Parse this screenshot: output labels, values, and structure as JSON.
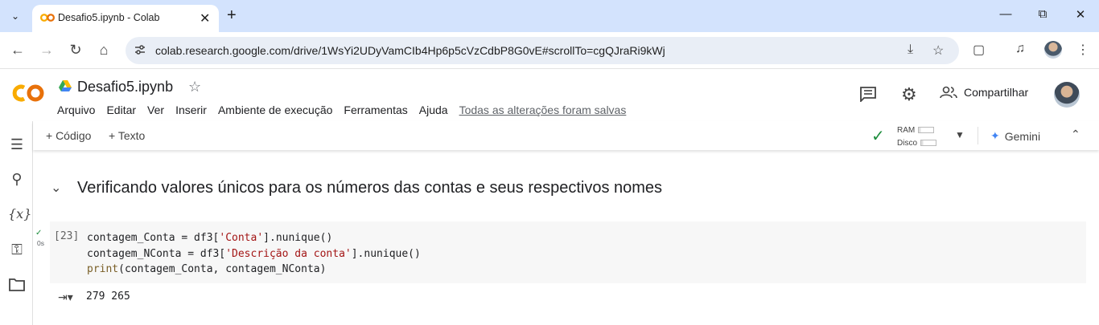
{
  "browser": {
    "tab_title": "Desafio5.ipynb - Colab",
    "url": "colab.research.google.com/drive/1WsYi2UDyVamCIb4Hp6p5cVzCdbP8G0vE#scrollTo=cgQJraRi9kWj",
    "icons": [
      "tab-search-icon",
      "close-icon",
      "plus-icon",
      "minimize-icon",
      "restore-icon",
      "close-window-icon",
      "back-icon",
      "forward-icon",
      "reload-icon",
      "home-icon",
      "site-info-icon",
      "download-icon",
      "star-icon",
      "extensions-icon",
      "media-icon",
      "menu-icon"
    ]
  },
  "colab": {
    "notebook_title": "Desafio5.ipynb",
    "menu": [
      "Arquivo",
      "Editar",
      "Ver",
      "Inserir",
      "Ambiente de execução",
      "Ferramentas",
      "Ajuda"
    ],
    "saved_status": "Todas as alterações foram salvas",
    "share_label": "Compartilhar"
  },
  "toolbar": {
    "add_code": "+ Código",
    "add_text": "+ Texto",
    "ram_label": "RAM",
    "disk_label": "Disco",
    "gemini_label": "Gemini"
  },
  "notebook": {
    "heading": "Verificando valores únicos para os números das contas e seus respectivos nomes",
    "cell": {
      "execution_count": "[23]",
      "run_time": "0s",
      "code_lines": [
        "contagem_Conta = df3['Conta'].nunique()",
        "contagem_NConta = df3['Descrição da conta'].nunique()",
        "print(contagem_Conta, contagem_NConta)"
      ],
      "output": "279 265"
    }
  }
}
